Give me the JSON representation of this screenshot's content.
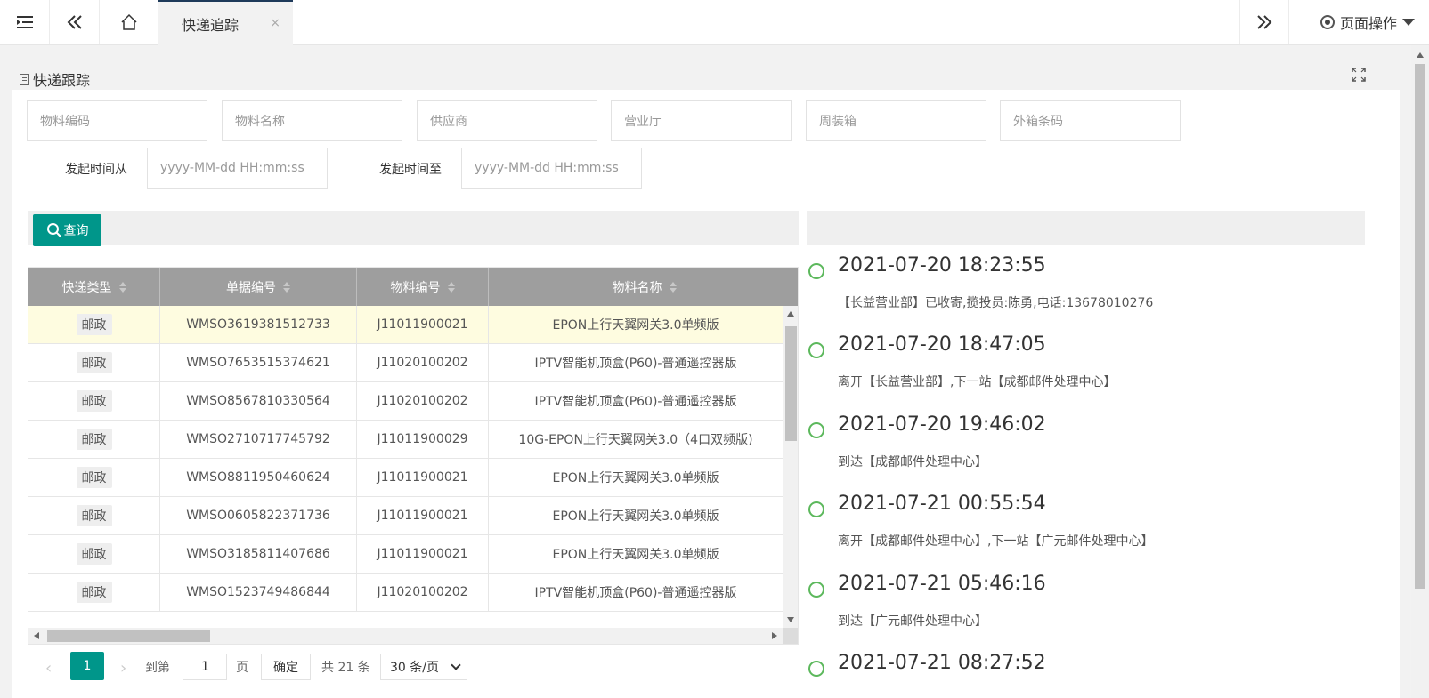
{
  "tabs": {
    "active_label": "快递追踪",
    "close": "×"
  },
  "page_ops": "页面操作",
  "panel": {
    "title": "快递跟踪"
  },
  "filters": {
    "material_code": "物料编码",
    "material_name": "物料名称",
    "supplier": "供应商",
    "business_hall": "营业厅",
    "turnover_box": "周装箱",
    "outer_box_barcode": "外箱条码",
    "start_from_label": "发起时间从",
    "start_to_label": "发起时间至",
    "datetime_placeholder": "yyyy-MM-dd HH:mm:ss"
  },
  "query_button": "查询",
  "table": {
    "headers": [
      "快递类型",
      "单据编号",
      "物料编号",
      "物料名称"
    ],
    "rows": [
      {
        "type": "邮政",
        "doc_no": "WMSO3619381512733",
        "mat_no": "J11011900021",
        "mat_name": "EPON上行天翼网关3.0单频版"
      },
      {
        "type": "邮政",
        "doc_no": "WMSO7653515374621",
        "mat_no": "J11020100202",
        "mat_name": "IPTV智能机顶盒(P60)-普通遥控器版"
      },
      {
        "type": "邮政",
        "doc_no": "WMSO8567810330564",
        "mat_no": "J11020100202",
        "mat_name": "IPTV智能机顶盒(P60)-普通遥控器版"
      },
      {
        "type": "邮政",
        "doc_no": "WMSO2710717745792",
        "mat_no": "J11011900029",
        "mat_name": "10G-EPON上行天翼网关3.0（4口双频版)"
      },
      {
        "type": "邮政",
        "doc_no": "WMSO8811950460624",
        "mat_no": "J11011900021",
        "mat_name": "EPON上行天翼网关3.0单频版"
      },
      {
        "type": "邮政",
        "doc_no": "WMSO0605822371736",
        "mat_no": "J11011900021",
        "mat_name": "EPON上行天翼网关3.0单频版"
      },
      {
        "type": "邮政",
        "doc_no": "WMSO3185811407686",
        "mat_no": "J11011900021",
        "mat_name": "EPON上行天翼网关3.0单频版"
      },
      {
        "type": "邮政",
        "doc_no": "WMSO1523749486844",
        "mat_no": "J11020100202",
        "mat_name": "IPTV智能机顶盒(P60)-普通遥控器版"
      }
    ]
  },
  "pager": {
    "current": "1",
    "goto_label": "到第",
    "goto_value": "1",
    "page_unit": "页",
    "confirm": "确定",
    "total": "共 21 条",
    "page_size": "30 条/页"
  },
  "timeline": [
    {
      "time": "2021-07-20 18:23:55",
      "desc": "【长益营业部】已收寄,揽投员:陈勇,电话:13678010276"
    },
    {
      "time": "2021-07-20 18:47:05",
      "desc": "离开【长益营业部】,下一站【成都邮件处理中心】"
    },
    {
      "time": "2021-07-20 19:46:02",
      "desc": "到达【成都邮件处理中心】"
    },
    {
      "time": "2021-07-21 00:55:54",
      "desc": "离开【成都邮件处理中心】,下一站【广元邮件处理中心】"
    },
    {
      "time": "2021-07-21 05:46:16",
      "desc": "到达【广元邮件处理中心】"
    },
    {
      "time": "2021-07-21 08:27:52",
      "desc": ""
    }
  ],
  "colors": {
    "primary": "#00968a",
    "timeline_dot": "#5cb85c",
    "table_header": "#9e9e9e",
    "selected_row": "#fefce0"
  }
}
